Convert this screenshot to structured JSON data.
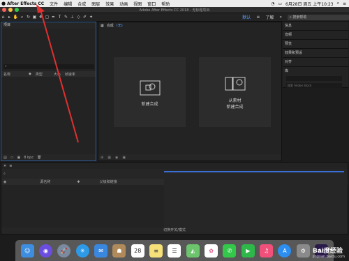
{
  "menubar": {
    "apple": "",
    "app_name": "After Effects CC",
    "items": [
      "文件",
      "编辑",
      "合成",
      "图层",
      "效果",
      "动画",
      "视图",
      "窗口",
      "帮助"
    ],
    "datetime": "6月28日 周五 上午10:23"
  },
  "window": {
    "title": "Adobe After Effects CC 2018 - 无标题项目"
  },
  "toolbar": {
    "workspaces": [
      "默认",
      "≡",
      "了解"
    ],
    "search_placeholder": "搜索帮助"
  },
  "project": {
    "title": "项目",
    "columns": [
      "名称",
      "类型",
      "大小",
      "帧速率"
    ],
    "footer_bpc": "8 bpc"
  },
  "comp": {
    "tab_label": "合成",
    "tab_value": "(无)",
    "card_new": "新建合成",
    "card_from_footage_line1": "从素材",
    "card_from_footage_line2": "新建合成"
  },
  "right_panels": {
    "items": [
      "信息",
      "音频",
      "预览",
      "效果和预设",
      "对齐"
    ],
    "library": "库",
    "library_search": "搜索 Adobe Stock"
  },
  "timeline": {
    "column_source": "源名称",
    "column_parent": "父级和链接",
    "footer": "切换开关/模式"
  },
  "dock": {
    "icons": [
      "finder-icon",
      "siri-icon",
      "launchpad-icon",
      "safari-icon",
      "mail-icon",
      "contacts-icon",
      "calendar-icon",
      "notes-icon",
      "reminders-icon",
      "maps-icon",
      "photos-icon",
      "messages-icon",
      "facetime-icon",
      "music-icon",
      "appstore-icon",
      "preferences-icon",
      "after-effects-icon"
    ],
    "calendar_day": "28"
  },
  "watermark": {
    "brand": "Bai度经验",
    "url": "jingyan.baidu.com"
  },
  "colors": {
    "accent": "#2f5f9a",
    "arrow": "#e03030"
  }
}
